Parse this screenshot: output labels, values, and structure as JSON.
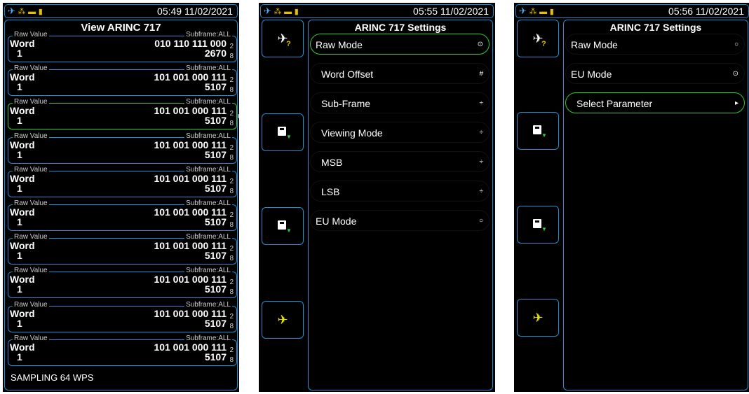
{
  "screens": [
    {
      "status": {
        "time": "05:49 11/02/2021"
      },
      "title": "View ARINC 717",
      "rows": [
        {
          "label_left": "Raw Value",
          "label_right": "Subframe:ALL",
          "word": "Word",
          "word_num": "1",
          "binary": "010 110 111 000",
          "binary_base": "2",
          "octal": "2670",
          "octal_base": "8",
          "selected": false
        },
        {
          "label_left": "Raw Value",
          "label_right": "Subframe:ALL",
          "word": "Word",
          "word_num": "1",
          "binary": "101 001 000 111",
          "binary_base": "2",
          "octal": "5107",
          "octal_base": "8",
          "selected": false
        },
        {
          "label_left": "Raw Value",
          "label_right": "Subframe:ALL",
          "word": "Word",
          "word_num": "1",
          "binary": "101 001 000 111",
          "binary_base": "2",
          "octal": "5107",
          "octal_base": "8",
          "selected": true
        },
        {
          "label_left": "Raw Value",
          "label_right": "Subframe:ALL",
          "word": "Word",
          "word_num": "1",
          "binary": "101 001 000 111",
          "binary_base": "2",
          "octal": "5107",
          "octal_base": "8",
          "selected": false
        },
        {
          "label_left": "Raw Value",
          "label_right": "Subframe:ALL",
          "word": "Word",
          "word_num": "1",
          "binary": "101 001 000 111",
          "binary_base": "2",
          "octal": "5107",
          "octal_base": "8",
          "selected": false
        },
        {
          "label_left": "Raw Value",
          "label_right": "Subframe:ALL",
          "word": "Word",
          "word_num": "1",
          "binary": "101 001 000 111",
          "binary_base": "2",
          "octal": "5107",
          "octal_base": "8",
          "selected": false
        },
        {
          "label_left": "Raw Value",
          "label_right": "Subframe:ALL",
          "word": "Word",
          "word_num": "1",
          "binary": "101 001 000 111",
          "binary_base": "2",
          "octal": "5107",
          "octal_base": "8",
          "selected": false
        },
        {
          "label_left": "Raw Value",
          "label_right": "Subframe:ALL",
          "word": "Word",
          "word_num": "1",
          "binary": "101 001 000 111",
          "binary_base": "2",
          "octal": "5107",
          "octal_base": "8",
          "selected": false
        },
        {
          "label_left": "Raw Value",
          "label_right": "Subframe:ALL",
          "word": "Word",
          "word_num": "1",
          "binary": "101 001 000 111",
          "binary_base": "2",
          "octal": "5107",
          "octal_base": "8",
          "selected": false
        },
        {
          "label_left": "Raw Value",
          "label_right": "Subframe:ALL",
          "word": "Word",
          "word_num": "1",
          "binary": "101 001 000 111",
          "binary_base": "2",
          "octal": "5107",
          "octal_base": "8",
          "selected": false
        }
      ],
      "footer": "SAMPLING  64 WPS"
    },
    {
      "status": {
        "time": "05:55 11/02/2021"
      },
      "title": "ARINC 717 Settings",
      "items": [
        {
          "label": "Raw Mode",
          "indicator": "⊙",
          "selected": true,
          "indent": false
        },
        {
          "label": "Word Offset",
          "indicator": "#",
          "selected": false,
          "indent": true
        },
        {
          "label": "Sub-Frame",
          "indicator": "÷",
          "selected": false,
          "indent": true
        },
        {
          "label": "Viewing Mode",
          "indicator": "÷",
          "selected": false,
          "indent": true
        },
        {
          "label": "MSB",
          "indicator": "÷",
          "selected": false,
          "indent": true
        },
        {
          "label": "LSB",
          "indicator": "÷",
          "selected": false,
          "indent": true
        },
        {
          "label": "EU Mode",
          "indicator": "○",
          "selected": false,
          "indent": false
        }
      ]
    },
    {
      "status": {
        "time": "05:56 11/02/2021"
      },
      "title": "ARINC 717 Settings",
      "items": [
        {
          "label": "Raw Mode",
          "indicator": "○",
          "selected": false,
          "indent": false
        },
        {
          "label": "EU Mode",
          "indicator": "⊙",
          "selected": false,
          "indent": false
        },
        {
          "label": "Select Parameter",
          "indicator": "▸",
          "selected": true,
          "indent": true
        }
      ]
    }
  ],
  "icons": {
    "status": [
      "airplane-icon",
      "network-icon",
      "power-plug-icon",
      "battery-icon"
    ],
    "side": [
      "airplane-help-icon",
      "save-icon",
      "save-icon",
      "airplane-icon"
    ]
  },
  "colors": {
    "accent": "#1f8fd0",
    "selected": "#33cc33",
    "warning": "#e6c000"
  }
}
